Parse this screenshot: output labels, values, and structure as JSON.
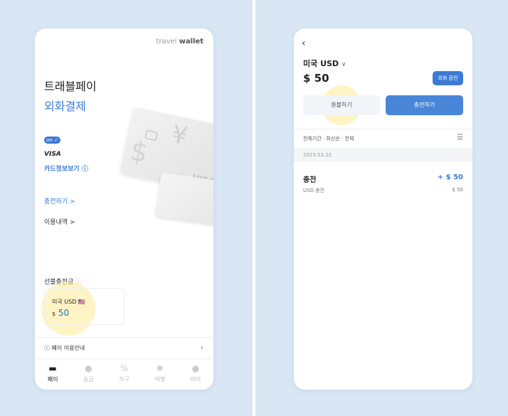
{
  "left": {
    "brand_light": "travel ",
    "brand_bold": "wallet",
    "title_line1": "트래블페이",
    "title_line2": "외화결제",
    "toggle_label": "on",
    "card_brand": "VISA",
    "card_info_link": "카드정보보기 ⓘ",
    "charge_link": "충전하기 >",
    "history_link": "이용내역 >",
    "prepaid_label": "선불충전금",
    "balance_currency": "미국 USD 🇺🇸",
    "balance_symbol": "$",
    "balance_value": "50",
    "guide_text": "ⓘ 페이 이용안내",
    "guide_chevron": "›",
    "tabs": [
      {
        "label": "페이",
        "icon": "card-icon"
      },
      {
        "label": "송금",
        "icon": "dollar-coin-icon"
      },
      {
        "label": "직구",
        "icon": "percent-tag-icon"
      },
      {
        "label": "여행",
        "icon": "palm-tree-icon"
      },
      {
        "label": "마이",
        "icon": "person-icon"
      }
    ]
  },
  "right": {
    "currency_select": "미국 USD",
    "balance": "$ 50",
    "fx_button": "외화 환전",
    "refund_button": "환불하기",
    "charge_button": "충전하기",
    "filter_text": "전체기간 · 최신순 · 전체",
    "date": "2023.03.22",
    "tx_title": "충전",
    "tx_amount": "+ $ 50",
    "tx_sub": "USD 충전",
    "tx_sub_amount": "$ 50"
  },
  "colors": {
    "accent": "#3b7bd4",
    "background": "#d9e7f4",
    "highlight": "#ffeb96"
  }
}
